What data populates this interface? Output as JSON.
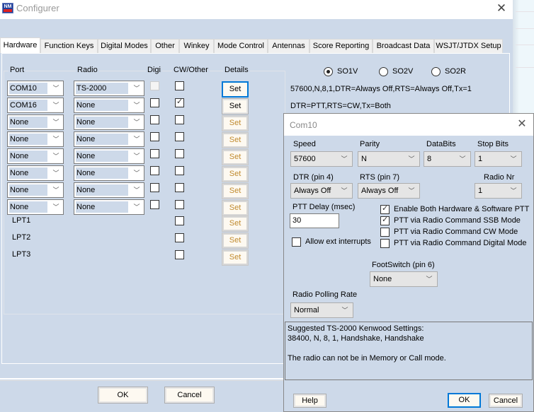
{
  "window": {
    "title": "Configurer",
    "icon": "n1mm-logo-icon",
    "close_icon": "close-icon"
  },
  "tabs": [
    {
      "label": "Hardware",
      "active": true
    },
    {
      "label": "Function Keys",
      "active": false
    },
    {
      "label": "Digital Modes",
      "active": false
    },
    {
      "label": "Other",
      "active": false
    },
    {
      "label": "Winkey",
      "active": false
    },
    {
      "label": "Mode Control",
      "active": false
    },
    {
      "label": "Antennas",
      "active": false
    },
    {
      "label": "Score Reporting",
      "active": false
    },
    {
      "label": "Broadcast Data",
      "active": false
    },
    {
      "label": "WSJT/JTDX Setup",
      "active": false
    }
  ],
  "hardware": {
    "columns": {
      "port": "Port",
      "radio": "Radio",
      "digi": "Digi",
      "cw_other": "CW/Other",
      "details": "Details"
    },
    "rows": [
      {
        "port": "COM10",
        "radio": "TS-2000",
        "digi": false,
        "digi_enabled": false,
        "cw": false,
        "set": "Set",
        "set_enabled": true,
        "set_focused": true
      },
      {
        "port": "COM16",
        "radio": "None",
        "digi": false,
        "digi_enabled": true,
        "cw": true,
        "set": "Set",
        "set_enabled": true,
        "set_focused": false
      },
      {
        "port": "None",
        "radio": "None",
        "digi": false,
        "digi_enabled": true,
        "cw": false,
        "set": "Set",
        "set_enabled": false,
        "set_focused": false
      },
      {
        "port": "None",
        "radio": "None",
        "digi": false,
        "digi_enabled": true,
        "cw": false,
        "set": "Set",
        "set_enabled": false,
        "set_focused": false
      },
      {
        "port": "None",
        "radio": "None",
        "digi": false,
        "digi_enabled": true,
        "cw": false,
        "set": "Set",
        "set_enabled": false,
        "set_focused": false
      },
      {
        "port": "None",
        "radio": "None",
        "digi": false,
        "digi_enabled": true,
        "cw": false,
        "set": "Set",
        "set_enabled": false,
        "set_focused": false
      },
      {
        "port": "None",
        "radio": "None",
        "digi": false,
        "digi_enabled": true,
        "cw": false,
        "set": "Set",
        "set_enabled": false,
        "set_focused": false
      },
      {
        "port": "None",
        "radio": "None",
        "digi": false,
        "digi_enabled": true,
        "cw": false,
        "set": "Set",
        "set_enabled": false,
        "set_focused": false
      }
    ],
    "lpt_rows": [
      {
        "label": "LPT1",
        "cw": false,
        "set": "Set"
      },
      {
        "label": "LPT2",
        "cw": false,
        "set": "Set"
      },
      {
        "label": "LPT3",
        "cw": false,
        "set": "Set"
      }
    ],
    "so_options": [
      {
        "label": "SO1V",
        "selected": true
      },
      {
        "label": "SO2V",
        "selected": false
      },
      {
        "label": "SO2R",
        "selected": false
      }
    ],
    "info_lines": [
      "57600,N,8,1,DTR=Always Off,RTS=Always Off,Tx=1",
      "DTR=PTT,RTS=CW,Tx=Both"
    ]
  },
  "footer": {
    "ok": "OK",
    "cancel": "Cancel"
  },
  "com_dialog": {
    "title": "Com10",
    "speed": {
      "label": "Speed",
      "value": "57600"
    },
    "parity": {
      "label": "Parity",
      "value": "N"
    },
    "databits": {
      "label": "DataBits",
      "value": "8"
    },
    "stopbits": {
      "label": "Stop Bits",
      "value": "1"
    },
    "dtr": {
      "label": "DTR (pin 4)",
      "value": "Always Off"
    },
    "rts": {
      "label": "RTS (pin 7)",
      "value": "Always Off"
    },
    "radio_nr": {
      "label": "Radio Nr",
      "value": "1"
    },
    "ptt_delay": {
      "label": "PTT Delay  (msec)",
      "value": "30"
    },
    "allow_ext": {
      "label": "Allow ext interrupts",
      "checked": false
    },
    "ptt_options": [
      {
        "label": "Enable Both Hardware & Software PTT",
        "checked": true
      },
      {
        "label": "PTT via Radio Command SSB Mode",
        "checked": true
      },
      {
        "label": "PTT via Radio Command CW Mode",
        "checked": false
      },
      {
        "label": "PTT via Radio Command Digital Mode",
        "checked": false
      }
    ],
    "footswitch": {
      "label": "FootSwitch (pin 6)",
      "value": "None"
    },
    "polling": {
      "label": "Radio Polling Rate",
      "value": "Normal"
    },
    "suggest_lines": [
      "Suggested TS-2000 Kenwood Settings:",
      "38400, N, 8, 1, Handshake, Handshake",
      "",
      "The radio can not be in Memory or Call mode."
    ],
    "help": "Help",
    "ok": "OK",
    "cancel": "Cancel"
  },
  "colors": {
    "panel": "#cdd9e9",
    "focus": "#0078d7",
    "disabled_text": "#c08a2e"
  }
}
